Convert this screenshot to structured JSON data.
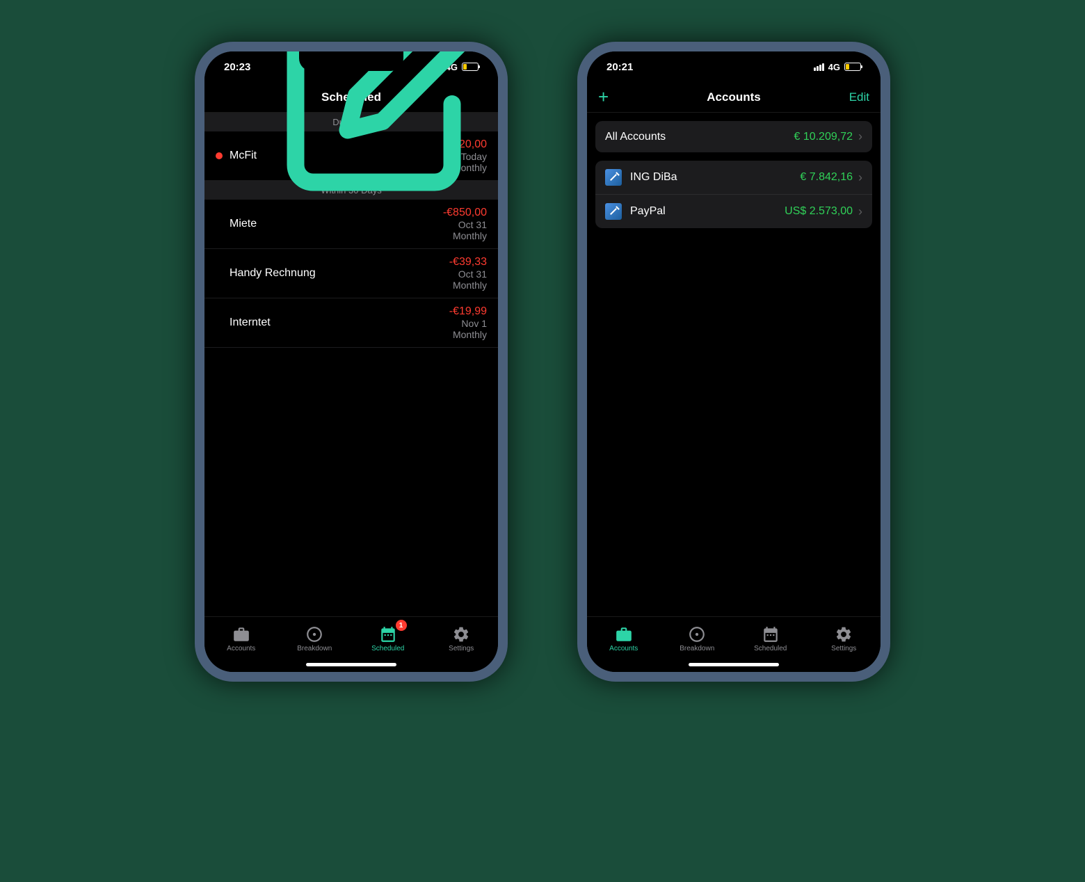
{
  "phone_left": {
    "status": {
      "time": "20:23",
      "network": "4G"
    },
    "header": {
      "title": "Scheduled"
    },
    "sections": {
      "due_now": {
        "header": "Due Now"
      },
      "within_30": {
        "header": "Within 30 Days"
      }
    },
    "items": [
      {
        "name": "McFit",
        "amount": "-€20,00",
        "date": "Today",
        "recurrence": "Monthly",
        "has_dot": true
      },
      {
        "name": "Miete",
        "amount": "-€850,00",
        "date": "Oct 31",
        "recurrence": "Monthly"
      },
      {
        "name": "Handy Rechnung",
        "amount": "-€39,33",
        "date": "Oct 31",
        "recurrence": "Monthly"
      },
      {
        "name": "Interntet",
        "amount": "-€19,99",
        "date": "Nov 1",
        "recurrence": "Monthly"
      }
    ],
    "tabs": {
      "accounts": "Accounts",
      "breakdown": "Breakdown",
      "scheduled": "Scheduled",
      "settings": "Settings",
      "badge": "1"
    }
  },
  "phone_right": {
    "status": {
      "time": "20:21",
      "network": "4G"
    },
    "header": {
      "title": "Accounts",
      "edit": "Edit"
    },
    "all_accounts": {
      "label": "All Accounts",
      "amount": "€ 10.209,72"
    },
    "accounts": [
      {
        "name": "ING DiBa",
        "amount": "€ 7.842,16"
      },
      {
        "name": "PayPal",
        "amount": "US$ 2.573,00"
      }
    ],
    "tabs": {
      "accounts": "Accounts",
      "breakdown": "Breakdown",
      "scheduled": "Scheduled",
      "settings": "Settings"
    }
  }
}
